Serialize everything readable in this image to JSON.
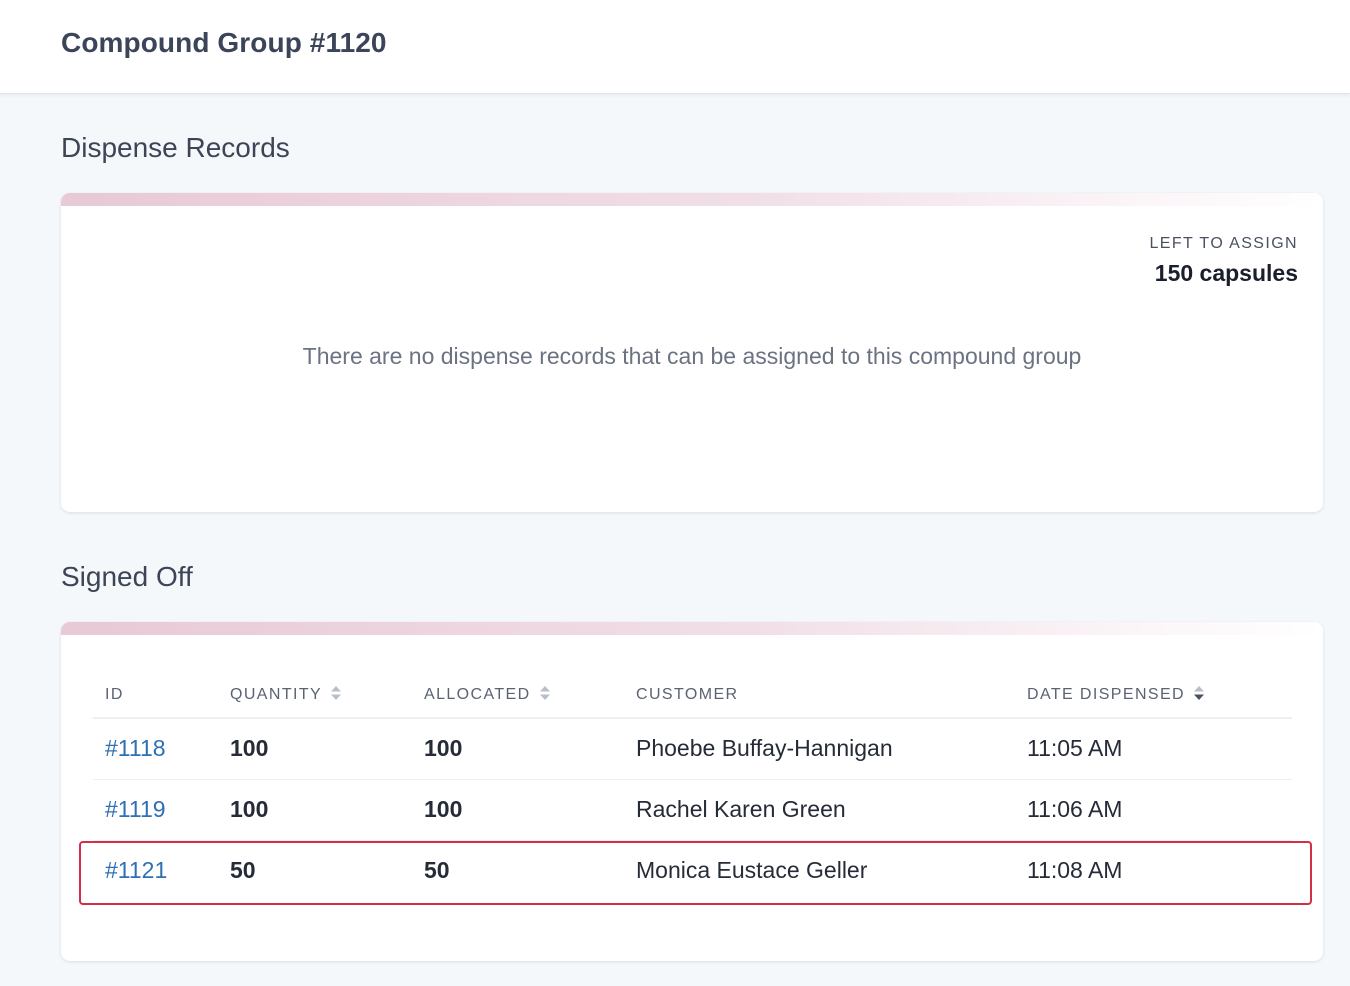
{
  "header": {
    "title": "Compound Group #1120"
  },
  "dispense_records": {
    "section_title": "Dispense Records",
    "left_to_assign_label": "LEFT TO ASSIGN",
    "left_to_assign_value": "150 capsules",
    "empty_message": "There are no dispense records that can be assigned to this compound group"
  },
  "signed_off": {
    "section_title": "Signed Off",
    "columns": {
      "id": "ID",
      "quantity": "QUANTITY",
      "allocated": "ALLOCATED",
      "customer": "CUSTOMER",
      "date_dispensed": "DATE DISPENSED"
    },
    "rows": [
      {
        "id": "#1118",
        "quantity": "100",
        "allocated": "100",
        "customer": "Phoebe Buffay-Hannigan",
        "date_dispensed": "11:05 AM"
      },
      {
        "id": "#1119",
        "quantity": "100",
        "allocated": "100",
        "customer": "Rachel Karen Green",
        "date_dispensed": "11:06 AM"
      },
      {
        "id": "#1121",
        "quantity": "50",
        "allocated": "50",
        "customer": "Monica Eustace Geller",
        "date_dispensed": "11:08 AM"
      }
    ],
    "highlight_color": "#d32f47",
    "link_color": "#2f6fb6"
  }
}
